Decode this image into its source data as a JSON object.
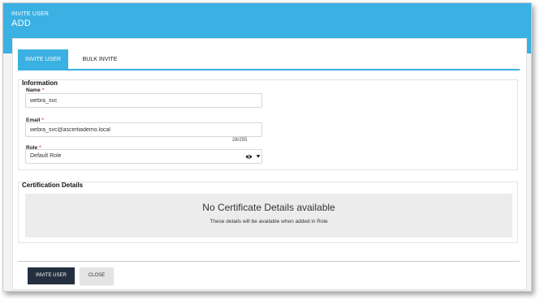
{
  "header": {
    "breadcrumb": "INVITE USER",
    "title": "ADD"
  },
  "tabs": [
    {
      "label": "INVITE USER",
      "active": true
    },
    {
      "label": "BULK INVITE",
      "active": false
    }
  ],
  "information": {
    "title": "Information",
    "name": {
      "label": "Name",
      "required_mark": "*",
      "value": "webra_svc"
    },
    "email": {
      "label": "Email",
      "required_mark": "*",
      "value": "webra_svc@ascertiademo.local",
      "counter": "28/255"
    },
    "role": {
      "label": "Role",
      "required_mark": "*",
      "value": "Default Role"
    }
  },
  "certification": {
    "title": "Certification Details",
    "empty_title": "No Certificate Details available",
    "empty_subtitle": "These details will be available when added in Role"
  },
  "footer": {
    "invite_label": "INVITE USER",
    "close_label": "CLOSE"
  },
  "icons": {
    "role_view": "eye-icon",
    "role_dropdown": "caret-down-icon"
  },
  "colors": {
    "accent": "#3ab0e3",
    "primary_button": "#24303f",
    "required": "#d9534f"
  }
}
